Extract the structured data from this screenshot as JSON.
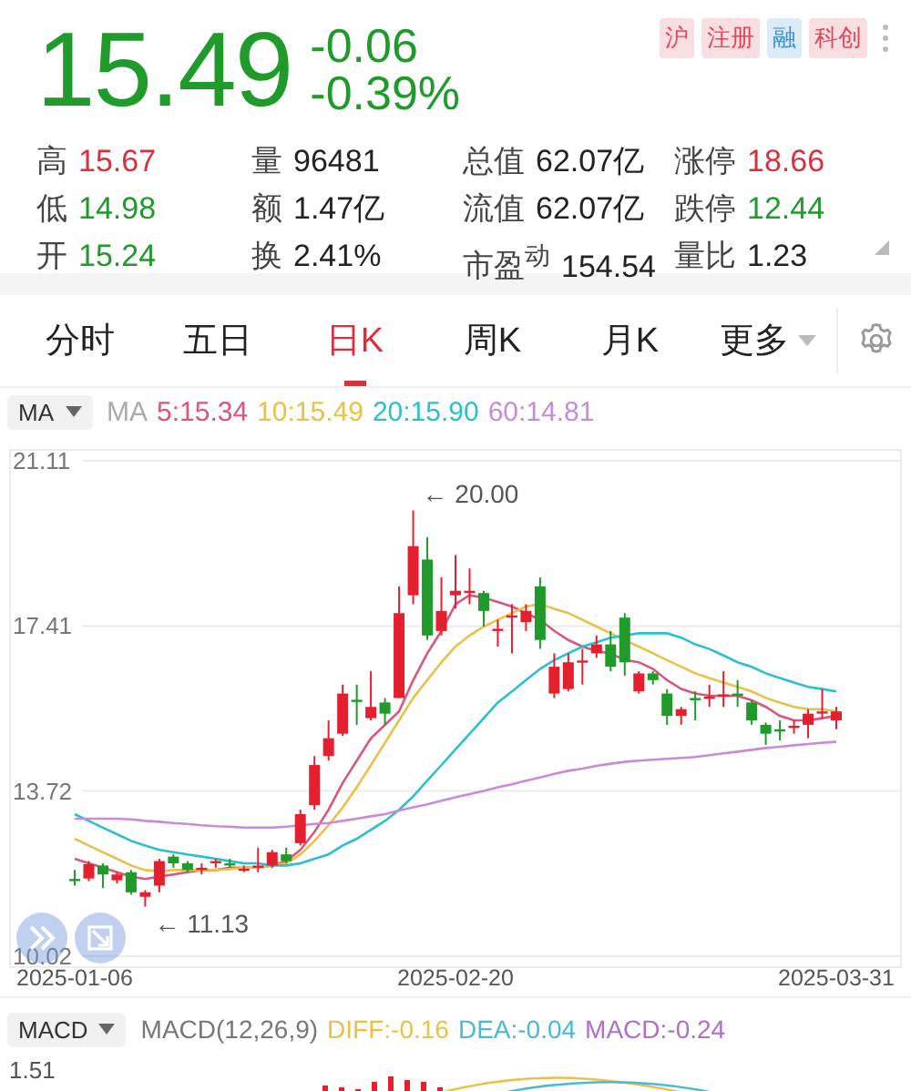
{
  "quote": {
    "price": "15.49",
    "change": "-0.06",
    "change_pct": "-0.39%",
    "color": "#1f9a2b"
  },
  "badges": [
    {
      "text": "沪",
      "color": "#e0465a"
    },
    {
      "text": "注册",
      "color": "#e0465a"
    },
    {
      "text": "融",
      "color": "#3a8fd6"
    },
    {
      "text": "科创",
      "color": "#e0465a"
    }
  ],
  "stats": [
    {
      "label": "高",
      "value": "15.67",
      "color": "#d9303f"
    },
    {
      "label": "量",
      "value": "96481",
      "color": "#222222"
    },
    {
      "label": "总值",
      "value": "62.07亿",
      "color": "#222222"
    },
    {
      "label": "涨停",
      "value": "18.66",
      "color": "#d9303f"
    },
    {
      "label": "低",
      "value": "14.98",
      "color": "#1f9a2b"
    },
    {
      "label": "额",
      "value": "1.47亿",
      "color": "#222222"
    },
    {
      "label": "流值",
      "value": "62.07亿",
      "color": "#222222"
    },
    {
      "label": "跌停",
      "value": "12.44",
      "color": "#1f9a2b"
    },
    {
      "label": "开",
      "value": "15.24",
      "color": "#1f9a2b"
    },
    {
      "label": "换",
      "value": "2.41%",
      "color": "#222222"
    },
    {
      "label": "市盈$^{动}$",
      "value": "154.54",
      "color": "#222222"
    },
    {
      "label": "量比",
      "value": "1.23",
      "color": "#222222"
    }
  ],
  "tabs": [
    {
      "label": "分时",
      "selected": false,
      "kind": "plain"
    },
    {
      "label": "五日",
      "selected": false,
      "kind": "plain"
    },
    {
      "label": "日K",
      "selected": true,
      "kind": "plain"
    },
    {
      "label": "周K",
      "selected": false,
      "kind": "plain"
    },
    {
      "label": "月K",
      "selected": false,
      "kind": "plain"
    },
    {
      "label": "更多",
      "selected": false,
      "kind": "dropdown"
    }
  ],
  "indicator": {
    "dropdown": "MA",
    "label": "MA",
    "values": [
      {
        "text": "5:15.34",
        "color": "#d9577a"
      },
      {
        "text": "10:15.49",
        "color": "#e8c04a"
      },
      {
        "text": "20:15.90",
        "color": "#2bbfcf"
      },
      {
        "text": "60:14.81",
        "color": "#c98bd9"
      }
    ]
  },
  "chart": {
    "chart_data": {
      "type": "candlestick",
      "ylim": [
        10.02,
        21.11
      ],
      "yticks": [
        21.11,
        17.41,
        13.72,
        10.02
      ],
      "categories": [
        "2025-01-06",
        null,
        null,
        null,
        null,
        null,
        null,
        null,
        null,
        null,
        null,
        null,
        null,
        null,
        null,
        null,
        null,
        null,
        null,
        null,
        null,
        null,
        null,
        null,
        null,
        null,
        null,
        "2025-02-20",
        null,
        null,
        null,
        null,
        null,
        null,
        null,
        null,
        null,
        null,
        null,
        null,
        null,
        null,
        null,
        null,
        null,
        null,
        null,
        null,
        null,
        null,
        null,
        null,
        null,
        null,
        "2025-03-31"
      ],
      "annotations": [
        "← 20.00",
        "← 11.13"
      ],
      "ohlc": [
        [
          11.75,
          11.95,
          11.6,
          11.74
        ],
        [
          11.76,
          12.15,
          11.7,
          12.08
        ],
        [
          12.05,
          12.1,
          11.55,
          11.85
        ],
        [
          11.72,
          11.9,
          11.65,
          11.85
        ],
        [
          11.9,
          11.95,
          11.4,
          11.45
        ],
        [
          11.35,
          11.5,
          11.13,
          11.45
        ],
        [
          11.6,
          12.2,
          11.45,
          12.15
        ],
        [
          12.25,
          12.3,
          12.0,
          12.1
        ],
        [
          12.1,
          12.15,
          11.9,
          11.95
        ],
        [
          11.95,
          12.1,
          11.85,
          12.0
        ],
        [
          12.1,
          12.2,
          12.0,
          12.15
        ],
        [
          12.1,
          12.2,
          12.0,
          12.05
        ],
        [
          11.95,
          12.05,
          11.9,
          11.98
        ],
        [
          12.0,
          12.45,
          11.9,
          12.05
        ],
        [
          12.05,
          12.4,
          12.0,
          12.35
        ],
        [
          12.3,
          12.45,
          12.1,
          12.15
        ],
        [
          12.55,
          13.3,
          12.5,
          13.2
        ],
        [
          13.4,
          14.5,
          13.3,
          14.3
        ],
        [
          14.5,
          15.3,
          14.4,
          14.9
        ],
        [
          15.0,
          16.1,
          14.95,
          15.9
        ],
        [
          15.76,
          16.1,
          15.2,
          15.75
        ],
        [
          15.35,
          16.4,
          15.3,
          15.6
        ],
        [
          15.7,
          15.8,
          15.2,
          15.45
        ],
        [
          15.8,
          18.3,
          15.8,
          17.7
        ],
        [
          18.1,
          20.0,
          17.9,
          19.2
        ],
        [
          18.9,
          19.4,
          17.1,
          17.2
        ],
        [
          17.3,
          18.5,
          17.2,
          17.75
        ],
        [
          18.1,
          19.0,
          17.8,
          18.2
        ],
        [
          18.15,
          18.7,
          17.9,
          18.2
        ],
        [
          18.15,
          18.2,
          17.4,
          17.75
        ],
        [
          17.3,
          17.55,
          16.95,
          17.35
        ],
        [
          17.6,
          17.9,
          16.8,
          17.65
        ],
        [
          17.5,
          17.9,
          17.3,
          17.75
        ],
        [
          18.3,
          18.5,
          16.9,
          17.1
        ],
        [
          15.9,
          16.8,
          15.8,
          16.5
        ],
        [
          16.0,
          16.8,
          15.95,
          16.6
        ],
        [
          16.6,
          16.9,
          16.1,
          16.64
        ],
        [
          16.8,
          17.2,
          16.7,
          17.0
        ],
        [
          17.0,
          17.3,
          16.4,
          16.5
        ],
        [
          17.6,
          17.7,
          16.3,
          16.6
        ],
        [
          15.95,
          16.4,
          15.9,
          16.35
        ],
        [
          16.35,
          16.4,
          16.1,
          16.2
        ],
        [
          15.9,
          16.0,
          15.2,
          15.4
        ],
        [
          15.4,
          15.6,
          15.2,
          15.55
        ],
        [
          15.8,
          15.95,
          15.3,
          15.75
        ],
        [
          15.8,
          16.1,
          15.6,
          15.83
        ],
        [
          15.85,
          16.4,
          15.6,
          15.88
        ],
        [
          15.9,
          16.2,
          15.6,
          15.88
        ],
        [
          15.7,
          15.75,
          15.2,
          15.3
        ],
        [
          15.2,
          15.25,
          14.75,
          15.0
        ],
        [
          15.1,
          15.3,
          14.85,
          15.08
        ],
        [
          15.15,
          15.3,
          15.0,
          15.18
        ],
        [
          15.2,
          15.55,
          14.9,
          15.45
        ],
        [
          15.45,
          16.0,
          15.35,
          15.5
        ],
        [
          15.3,
          15.6,
          15.1,
          15.5
        ]
      ],
      "series": [
        {
          "type": "line",
          "color": "#d9577a",
          "values": [
            12.2,
            12.1,
            12.0,
            11.9,
            11.8,
            11.75,
            11.8,
            11.85,
            11.9,
            11.95,
            11.95,
            12.0,
            12.0,
            12.0,
            12.05,
            12.15,
            12.4,
            12.8,
            13.3,
            13.9,
            14.4,
            14.9,
            15.2,
            15.5,
            16.2,
            16.8,
            17.3,
            17.9,
            18.1,
            18.05,
            17.95,
            17.85,
            17.7,
            17.55,
            17.3,
            17.1,
            16.95,
            16.85,
            16.8,
            16.65,
            16.6,
            16.45,
            16.2,
            16.0,
            15.9,
            15.85,
            15.85,
            15.85,
            15.75,
            15.6,
            15.4,
            15.3,
            15.3,
            15.35,
            15.4
          ]
        },
        {
          "type": "line",
          "color": "#e8c04a",
          "values": [
            12.65,
            12.5,
            12.35,
            12.2,
            12.05,
            11.95,
            11.92,
            11.95,
            11.95,
            11.95,
            11.95,
            11.97,
            12.0,
            12.0,
            12.05,
            12.1,
            12.3,
            12.6,
            12.95,
            13.35,
            13.8,
            14.3,
            14.8,
            15.3,
            15.8,
            16.2,
            16.6,
            16.95,
            17.2,
            17.4,
            17.55,
            17.7,
            17.85,
            17.9,
            17.8,
            17.7,
            17.55,
            17.4,
            17.25,
            17.1,
            16.95,
            16.8,
            16.65,
            16.5,
            16.35,
            16.25,
            16.15,
            16.05,
            15.95,
            15.8,
            15.7,
            15.6,
            15.55,
            15.55,
            15.5
          ]
        },
        {
          "type": "line",
          "color": "#2bbfcf",
          "values": [
            13.2,
            13.05,
            12.9,
            12.75,
            12.6,
            12.5,
            12.4,
            12.35,
            12.3,
            12.25,
            12.2,
            12.15,
            12.1,
            12.1,
            12.05,
            12.05,
            12.1,
            12.2,
            12.3,
            12.5,
            12.65,
            12.85,
            13.05,
            13.3,
            13.6,
            13.95,
            14.3,
            14.65,
            15.0,
            15.35,
            15.7,
            15.95,
            16.2,
            16.45,
            16.65,
            16.8,
            16.95,
            17.05,
            17.15,
            17.2,
            17.25,
            17.25,
            17.25,
            17.15,
            17.0,
            16.9,
            16.75,
            16.6,
            16.5,
            16.35,
            16.25,
            16.15,
            16.05,
            16.0,
            15.95
          ]
        },
        {
          "type": "line",
          "color": "#c98bd9",
          "values": [
            13.1,
            13.1,
            13.1,
            13.1,
            13.08,
            13.05,
            13.03,
            13.0,
            12.98,
            12.95,
            12.93,
            12.92,
            12.9,
            12.9,
            12.9,
            12.92,
            12.95,
            12.98,
            13.0,
            13.05,
            13.1,
            13.15,
            13.2,
            13.28,
            13.35,
            13.42,
            13.5,
            13.58,
            13.65,
            13.72,
            13.8,
            13.87,
            13.95,
            14.02,
            14.1,
            14.17,
            14.22,
            14.28,
            14.33,
            14.37,
            14.4,
            14.42,
            14.44,
            14.46,
            14.48,
            14.52,
            14.56,
            14.6,
            14.64,
            14.68,
            14.71,
            14.74,
            14.77,
            14.8,
            14.82
          ]
        }
      ]
    }
  },
  "macd": {
    "dropdown": "MACD",
    "label": "MACD(12,26,9)",
    "values": [
      {
        "text": "DIFF:-0.16",
        "color": "#e8c04a"
      },
      {
        "text": "DEA:-0.04",
        "color": "#4bb8d6"
      },
      {
        "text": "MACD:-0.24",
        "color": "#b06fc9"
      }
    ],
    "top_tick": "1.51"
  }
}
